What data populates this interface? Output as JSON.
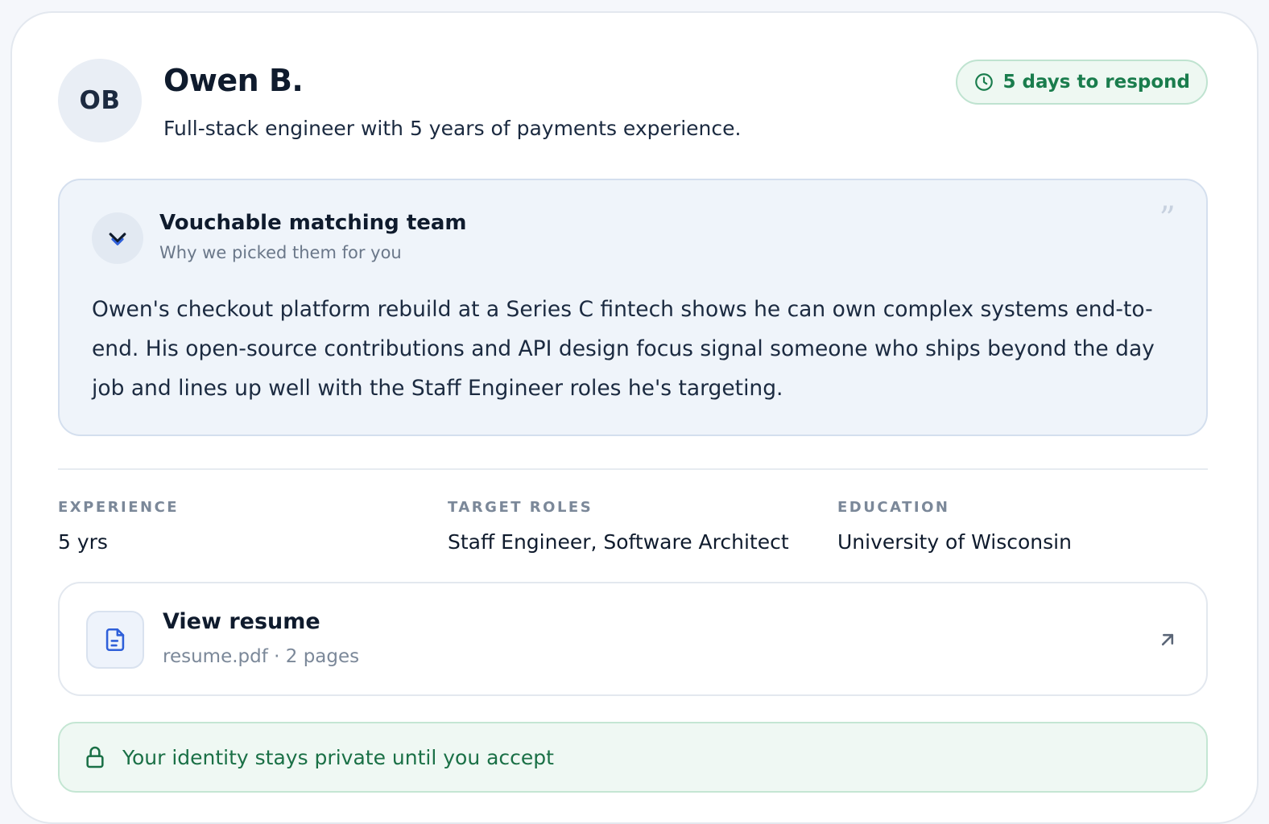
{
  "candidate": {
    "initials": "OB",
    "name": "Owen B.",
    "headline": "Full-stack engineer with 5 years of payments experience."
  },
  "respond_badge": {
    "label": "5 days to respond",
    "icon": "clock-icon",
    "color": "#1a7d4d"
  },
  "why": {
    "team_name": "Vouchable matching team",
    "subtitle": "Why we picked them for you",
    "quote_mark": "”",
    "text": "Owen's checkout platform rebuild at a Series C fintech shows he can own complex systems end-to-end. His open-source contributions and API design focus signal someone who ships beyond the day job and lines up well with the Staff Engineer roles he's targeting."
  },
  "facts": [
    {
      "label": "EXPERIENCE",
      "value": "5 yrs"
    },
    {
      "label": "TARGET ROLES",
      "value": "Staff Engineer, Software Architect"
    },
    {
      "label": "EDUCATION",
      "value": "University of Wisconsin"
    }
  ],
  "resume": {
    "title": "View resume",
    "meta": "resume.pdf · 2 pages",
    "icon": "file-text-icon",
    "open_icon": "arrow-up-right-icon"
  },
  "privacy": {
    "text": "Your identity stays private until you accept",
    "icon": "lock-icon",
    "color": "#1a7046"
  },
  "colors": {
    "accent_blue": "#2e5fd9",
    "success_green": "#1a7d4d"
  }
}
